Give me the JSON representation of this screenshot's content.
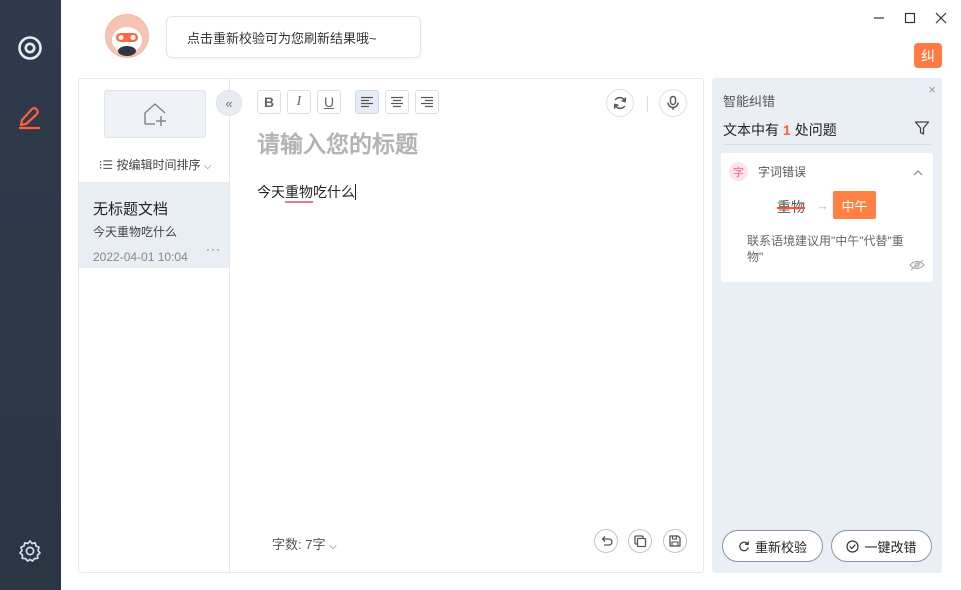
{
  "topbar": {
    "tip": "点击重新校验可为您刷新结果哦~",
    "badge": "纠"
  },
  "doclist": {
    "sort_label": "按编辑时间排序",
    "documents": [
      {
        "title": "无标题文档",
        "snippet": "今天重物吃什么",
        "date": "2022-04-01 10:04",
        "more": "···"
      }
    ]
  },
  "editor": {
    "collapse_glyph": "«",
    "toolbar": {
      "bold": "B",
      "italic": "I",
      "underline": "U"
    },
    "title_placeholder": "请输入您的标题",
    "body": {
      "before": "今天",
      "error": "重物",
      "after": "吃什么"
    },
    "word_count_label": "字数:",
    "word_count_value": "7字"
  },
  "panel": {
    "title": "智能纠错",
    "close": "×",
    "summary_prefix": "文本中有",
    "issue_count": "1",
    "summary_suffix": "处问题",
    "issue": {
      "badge": "字",
      "type": "字词错误",
      "wrong": "重物",
      "arrow": "→",
      "correct": "中午",
      "suggestion": "联系语境建议用\"中午\"代替\"重物\""
    },
    "recheck_label": "重新校验",
    "fix_all_label": "一键改错"
  },
  "colors": {
    "accent": "#ff7a45",
    "sidebar": "#2f3b4c",
    "error_underline": "#e4779c"
  }
}
